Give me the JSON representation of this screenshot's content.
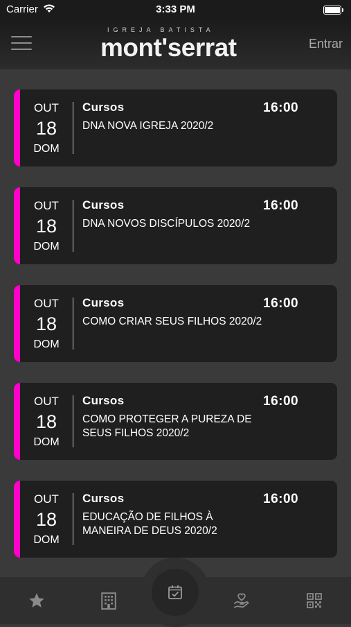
{
  "status_bar": {
    "carrier": "Carrier",
    "time": "3:33 PM"
  },
  "header": {
    "logo_top": "IGREJA BATISTA",
    "logo_main": "mont'serrat",
    "login_label": "Entrar"
  },
  "events": [
    {
      "month": "OUT",
      "day": "18",
      "weekday": "DOM",
      "category": "Cursos",
      "time": "16:00",
      "title": "DNA NOVA IGREJA 2020/2"
    },
    {
      "month": "OUT",
      "day": "18",
      "weekday": "DOM",
      "category": "Cursos",
      "time": "16:00",
      "title": "DNA NOVOS DISCÍPULOS 2020/2"
    },
    {
      "month": "OUT",
      "day": "18",
      "weekday": "DOM",
      "category": "Cursos",
      "time": "16:00",
      "title": "COMO CRIAR SEUS FILHOS 2020/2"
    },
    {
      "month": "OUT",
      "day": "18",
      "weekday": "DOM",
      "category": "Cursos",
      "time": "16:00",
      "title": "COMO PROTEGER A PUREZA DE SEUS FILHOS 2020/2"
    },
    {
      "month": "OUT",
      "day": "18",
      "weekday": "DOM",
      "category": "Cursos",
      "time": "16:00",
      "title": "EDUCAÇÃO DE FILHOS À MANEIRA DE DEUS 2020/2"
    }
  ],
  "colors": {
    "accent": "#ff00c8",
    "card": "#1f1f1f",
    "background": "#3a3a3a"
  },
  "bottom_nav": {
    "tabs": [
      "star-icon",
      "building-icon",
      "calendar-check-icon",
      "hand-heart-icon",
      "qr-code-icon"
    ],
    "active": "calendar-check-icon"
  }
}
